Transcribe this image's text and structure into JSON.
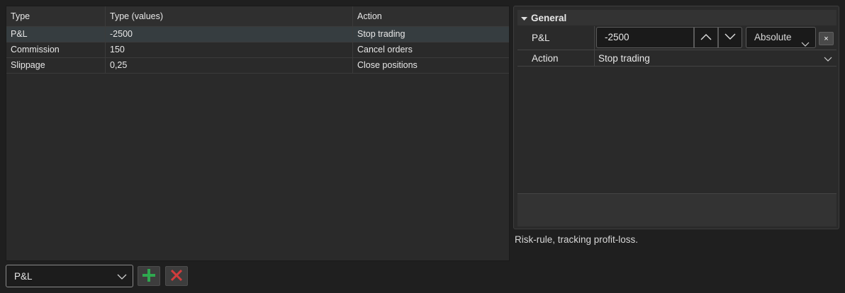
{
  "rules_table": {
    "columns": [
      "Type",
      "Type (values)",
      "Action"
    ],
    "rows": [
      {
        "type": "P&L",
        "value": "-2500",
        "action": "Stop trading",
        "selected": true
      },
      {
        "type": "Commission",
        "value": "150",
        "action": "Cancel orders",
        "selected": false
      },
      {
        "type": "Slippage",
        "value": "0,25",
        "action": "Close positions",
        "selected": false
      }
    ]
  },
  "bottom_bar": {
    "type_select_value": "P&L",
    "add_icon": "plus-icon",
    "remove_icon": "x-icon"
  },
  "properties": {
    "section_title": "General",
    "pnl_label": "P&L",
    "pnl_value": "-2500",
    "mode_value": "Absolute",
    "clear_label": "×",
    "action_label": "Action",
    "action_value": "Stop trading"
  },
  "description": "Risk-rule, tracking profit-loss.",
  "colors": {
    "background": "#1f1f1f",
    "panel": "#2a2a2a",
    "selected_row": "#363d40",
    "add_green": "#2fa84f",
    "remove_red": "#d23c3c"
  }
}
